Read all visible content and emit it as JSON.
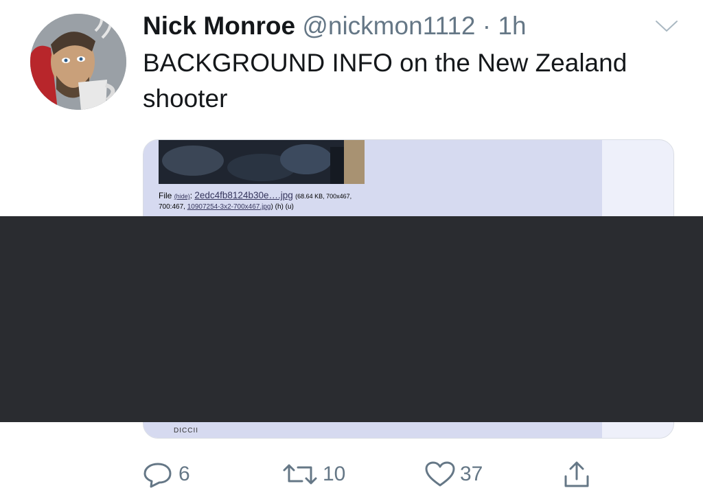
{
  "author": {
    "display_name": "Nick Monroe",
    "handle": "@nickmon1112",
    "separator": "·",
    "timestamp": "1h"
  },
  "tweet": {
    "text": "BACKGROUND INFO on the New Zealand shooter"
  },
  "media": {
    "file_label": "File",
    "hide_link": "(hide)",
    "file_name": "2edc4fb8124b30e….jpg",
    "file_info": "(68.64 KB, 700x467,",
    "file_info2": "700:467,",
    "original_name": "10907254-3x2-700x467.jpg",
    "tail_links": ") (h) (u)",
    "bottom_clip": "DICCII"
  },
  "actions": {
    "reply_count": "6",
    "retweet_count": "10",
    "like_count": "37"
  },
  "icons": {
    "reply": "reply-icon",
    "retweet": "retweet-icon",
    "like": "heart-icon",
    "share": "share-icon",
    "menu": "chevron-down-icon"
  },
  "colors": {
    "text": "#14171a",
    "secondary": "#657786",
    "redaction": "#2a2c30",
    "card_bg": "#d6daf0"
  }
}
